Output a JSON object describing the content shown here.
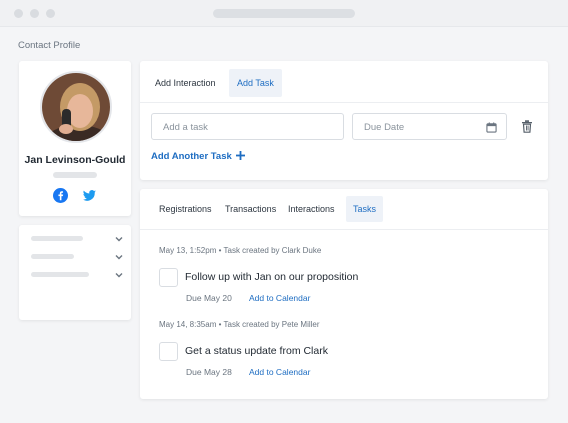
{
  "breadcrumb": "Contact Profile",
  "profile": {
    "name": "Jan Levinson-Gould"
  },
  "interaction_panel": {
    "tabs": [
      {
        "label": "Add Interaction",
        "active": false
      },
      {
        "label": "Add Task",
        "active": true
      }
    ],
    "task_placeholder": "Add a task",
    "due_placeholder": "Due Date",
    "add_another_label": "Add Another Task"
  },
  "tasks_panel": {
    "tabs": [
      {
        "label": "Registrations",
        "active": false
      },
      {
        "label": "Transactions",
        "active": false
      },
      {
        "label": "Interactions",
        "active": false
      },
      {
        "label": "Tasks",
        "active": true
      }
    ],
    "items": [
      {
        "date": "May 13, 1:52pm",
        "created_by": "Task created by Clark Duke",
        "title": "Follow up with Jan on our proposition",
        "due": "Due May 20",
        "calendar_link": "Add to Calendar"
      },
      {
        "date": "May 14, 8:35am",
        "created_by": "Task created by Pete Miller",
        "title": "Get a status update from Clark",
        "due": "Due May 28",
        "calendar_link": "Add to Calendar"
      }
    ]
  },
  "colors": {
    "accent": "#1e6dc2",
    "facebook": "#1877f2",
    "twitter": "#1d9bf0"
  }
}
